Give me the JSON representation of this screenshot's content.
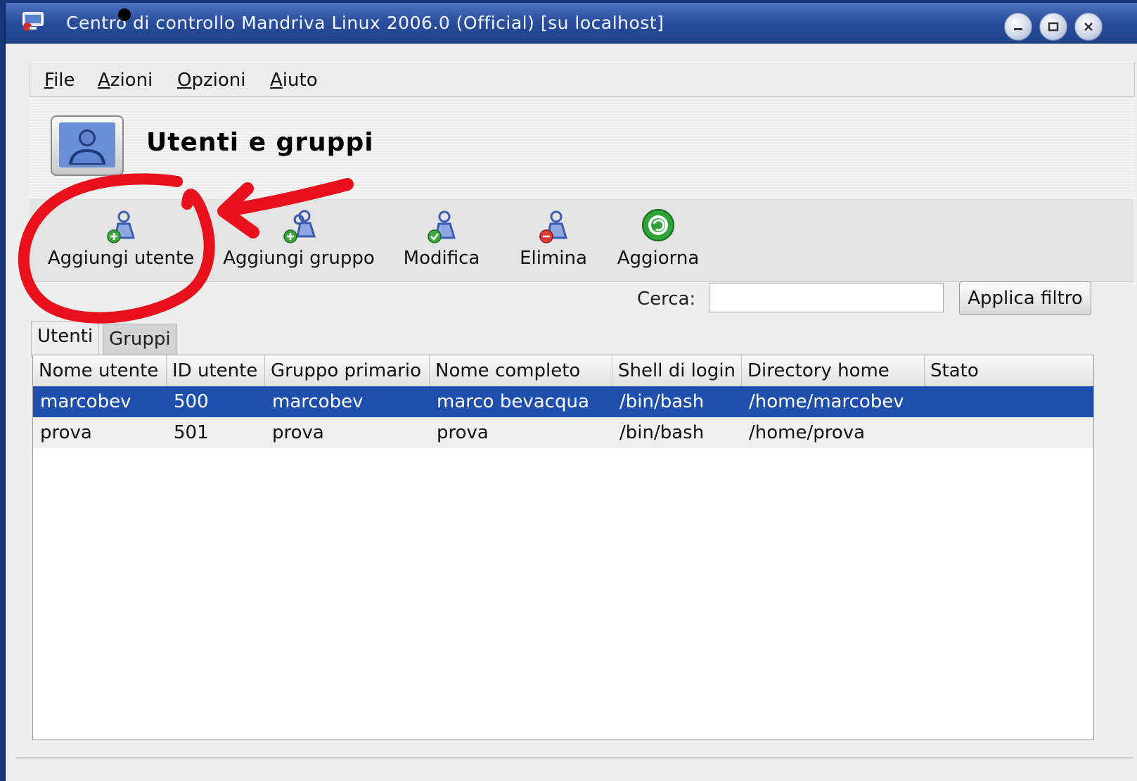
{
  "window": {
    "title": "Centro di controllo Mandriva Linux 2006.0 (Official) [su localhost]",
    "controls": [
      "minimize-icon",
      "maximize-icon",
      "close-icon"
    ]
  },
  "menubar": {
    "items": [
      {
        "underline": "F",
        "rest": "ile"
      },
      {
        "underline": "A",
        "rest": "zioni"
      },
      {
        "underline": "O",
        "rest": "pzioni"
      },
      {
        "underline": "A",
        "rest": "iuto"
      }
    ]
  },
  "header": {
    "title": "Utenti e gruppi",
    "icon": "user-icon"
  },
  "toolbar": {
    "add_user": "Aggiungi utente",
    "add_group": "Aggiungi gruppo",
    "edit": "Modifica",
    "delete": "Elimina",
    "refresh": "Aggiorna"
  },
  "search": {
    "label": "Cerca:",
    "value": "",
    "placeholder": "",
    "button": "Applica filtro"
  },
  "tabs": {
    "users": "Utenti",
    "groups": "Gruppi",
    "active": "Utenti"
  },
  "table": {
    "columns": [
      "Nome utente",
      "ID utente",
      "Gruppo primario",
      "Nome completo",
      "Shell di login",
      "Directory home",
      "Stato"
    ],
    "rows": [
      {
        "name": "marcobev",
        "id": "500",
        "group": "marcobev",
        "full": "marco bevacqua",
        "shell": "/bin/bash",
        "home": "/home/marcobev",
        "state": "",
        "selected": true
      },
      {
        "name": "prova",
        "id": "501",
        "group": "prova",
        "full": "prova",
        "shell": "/bin/bash",
        "home": "/home/prova",
        "state": "",
        "selected": false
      }
    ]
  },
  "colors": {
    "titlebar": "#2b4f9d",
    "selection": "#1f4fad",
    "annotation": "#e8101a"
  }
}
